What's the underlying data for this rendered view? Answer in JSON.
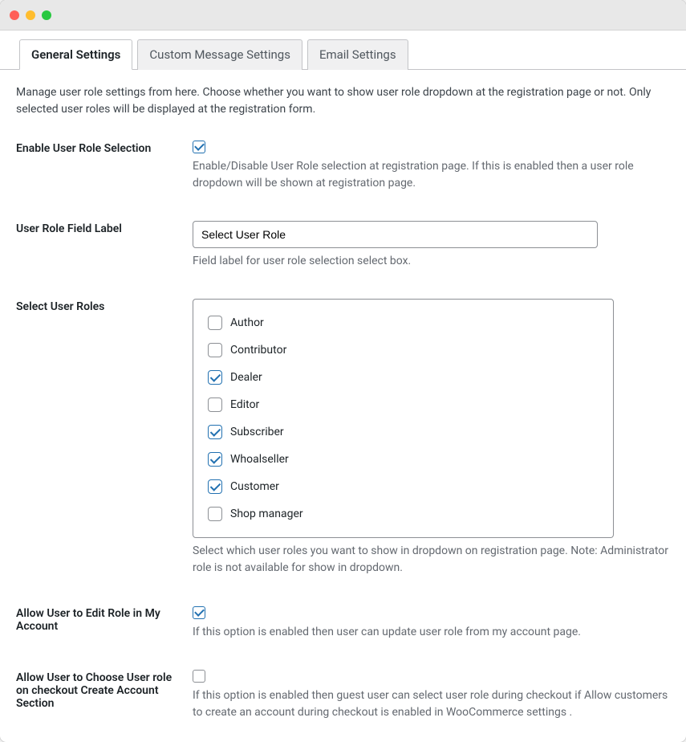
{
  "tabs": {
    "general": "General Settings",
    "custom_message": "Custom Message Settings",
    "email": "Email Settings"
  },
  "intro": "Manage user role settings from here. Choose whether you want to show user role dropdown at the registration page or not. Only selected user roles will be displayed at the registration form.",
  "fields": {
    "enable_role_selection": {
      "label": "Enable User Role Selection",
      "checked": true,
      "help": "Enable/Disable User Role selection at registration page. If this is enabled then a user role dropdown will be shown at registration page."
    },
    "role_field_label": {
      "label": "User Role Field Label",
      "value": "Select User Role",
      "help": "Field label for user role selection select box."
    },
    "select_user_roles": {
      "label": "Select User Roles",
      "help": "Select which user roles you want to show in dropdown on registration page. Note: Administrator role is not available for show in dropdown.",
      "options": [
        {
          "label": "Author",
          "checked": false
        },
        {
          "label": "Contributor",
          "checked": false
        },
        {
          "label": "Dealer",
          "checked": true
        },
        {
          "label": "Editor",
          "checked": false
        },
        {
          "label": "Subscriber",
          "checked": true
        },
        {
          "label": "Whoalseller",
          "checked": true
        },
        {
          "label": "Customer",
          "checked": true
        },
        {
          "label": "Shop manager",
          "checked": false
        }
      ]
    },
    "allow_edit_my_account": {
      "label": "Allow User to Edit Role in My Account",
      "checked": true,
      "help": "If this option is enabled then user can update user role from my account page."
    },
    "allow_choose_checkout": {
      "label": "Allow User to Choose User role on checkout Create Account Section",
      "checked": false,
      "help": "If this option is enabled then guest user can select user role during checkout if Allow customers to create an account during checkout is enabled in WooCommerce settings ."
    }
  }
}
